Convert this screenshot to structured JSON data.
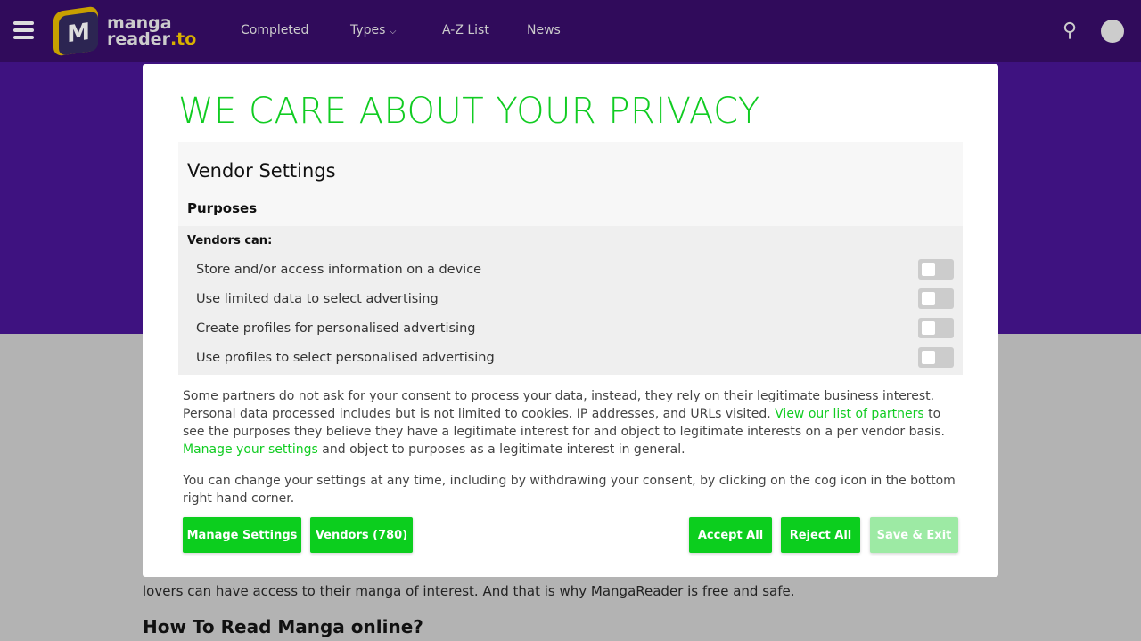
{
  "header": {
    "logo_top": "manga",
    "logo_bottom": "reader",
    "logo_tld": ".to",
    "nav": [
      "Completed",
      "Types",
      "A-Z List",
      "News"
    ]
  },
  "background": {
    "line": "lovers can have access to their manga of interest. And that is why MangaReader is free and safe.",
    "heading": "How To Read Manga online?"
  },
  "modal": {
    "title": "WE CARE ABOUT YOUR PRIVACY",
    "vendor_settings": "Vendor Settings",
    "purposes": "Purposes",
    "vendors_can": "Vendors can:",
    "items": [
      {
        "label": "Store and/or access information on a device",
        "enabled": false
      },
      {
        "label": "Use limited data to select advertising",
        "enabled": false
      },
      {
        "label": "Create profiles for personalised advertising",
        "enabled": false
      },
      {
        "label": "Use profiles to select personalised advertising",
        "enabled": false
      }
    ],
    "para1_a": "Some partners do not ask for your consent to process your data, instead, they rely on their legitimate business interest. Personal data processed includes but is not limited to cookies, IP addresses, and URLs visited. ",
    "para1_link1": "View our list of partners",
    "para1_b": " to see the purposes they believe they have a legitimate interest for and object to legitimate interests on a per vendor basis. ",
    "para1_link2": "Manage your settings",
    "para1_c": " and object to purposes as a legitimate interest in general.",
    "para2": "You can change your settings at any time, including by withdrawing your consent, by clicking on the cog icon in the bottom right hand corner.",
    "buttons": {
      "manage": "Manage Settings",
      "vendors": "Vendors (780)",
      "accept": "Accept All",
      "reject": "Reject All",
      "save": "Save & Exit"
    }
  }
}
